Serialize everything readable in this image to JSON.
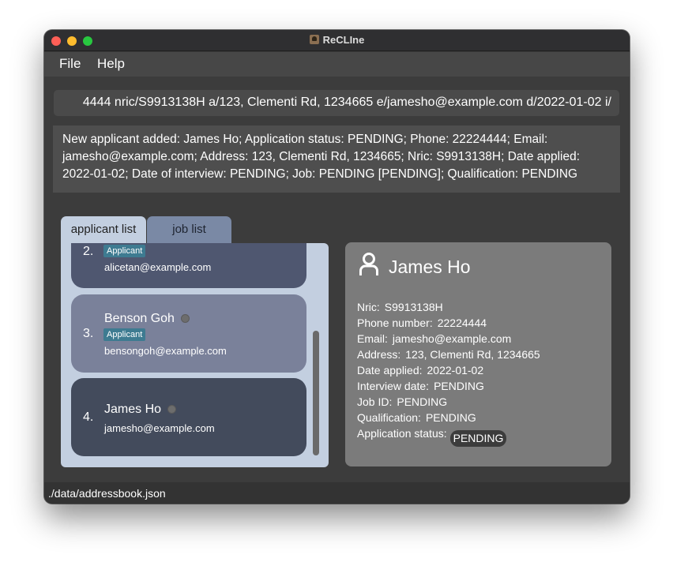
{
  "window": {
    "title": "ReCLIne"
  },
  "menu": [
    {
      "label": "File"
    },
    {
      "label": "Help"
    }
  ],
  "command": {
    "value": "4444 nric/S9913138H a/123, Clementi Rd, 1234665 e/jamesho@example.com d/2022-01-02 i/"
  },
  "result": {
    "text": "New applicant added: James Ho; Application status: PENDING; Phone: 22224444; Email: jamesho@example.com; Address: 123, Clementi Rd, 1234665; Nric: S9913138H; Date applied: 2022-01-02; Date of interview: PENDING; Job: PENDING [PENDING]; Qualification: PENDING"
  },
  "tabs": [
    {
      "label": "applicant list",
      "active": true
    },
    {
      "label": "job list",
      "active": false
    }
  ],
  "applicants": [
    {
      "index": "2.",
      "name": "",
      "tag": "Applicant",
      "email": "alicetan@example.com"
    },
    {
      "index": "3.",
      "name": "Benson Goh",
      "tag": "Applicant",
      "email": "bensongoh@example.com"
    },
    {
      "index": "4.",
      "name": "James Ho",
      "tag": "",
      "email": "jamesho@example.com"
    }
  ],
  "detail": {
    "name": "James Ho",
    "rows": [
      {
        "label": "Nric:",
        "value": "S9913138H"
      },
      {
        "label": "Phone number:",
        "value": "22224444"
      },
      {
        "label": "Email:",
        "value": "jamesho@example.com"
      },
      {
        "label": "Address:",
        "value": "123, Clementi Rd, 1234665"
      },
      {
        "label": "Date applied:",
        "value": "2022-01-02"
      },
      {
        "label": "Interview date:",
        "value": "PENDING"
      },
      {
        "label": "Job ID:",
        "value": "PENDING"
      },
      {
        "label": "Qualification:",
        "value": "PENDING"
      }
    ],
    "status_label": "Application status:",
    "status_value": "PENDING"
  },
  "statusbar": {
    "path": "./data/addressbook.json"
  },
  "colors": {
    "window_bg": "#3c3c3c",
    "list_panel": "#c3cfe0",
    "selected_card": "#434b5c",
    "tag": "#3e7b91",
    "detail_panel": "#7b7b7b"
  }
}
